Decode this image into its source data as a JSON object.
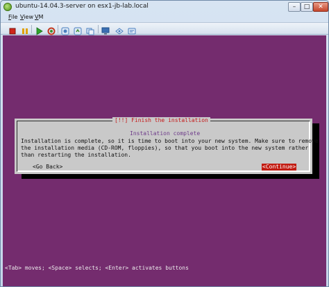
{
  "window": {
    "title": "ubuntu-14.04.3-server on esx1-jb-lab.local",
    "icon": "vm-console-app-icon",
    "controls": {
      "minimize": "–",
      "maximize": "□",
      "close": "✕"
    }
  },
  "menubar": {
    "items": [
      "File",
      "View",
      "VM"
    ]
  },
  "toolbar": {
    "buttons": [
      {
        "name": "power-off",
        "icon": "stop-square-icon",
        "color": "#d0261b"
      },
      {
        "name": "suspend",
        "icon": "pause-icon",
        "color": "#e0a100"
      },
      {
        "name": "power-on",
        "icon": "play-triangle-icon",
        "color": "#2fa52a"
      },
      {
        "name": "reset",
        "icon": "reset-icon",
        "color": "#c4391f"
      },
      {
        "name": "snapshot-take",
        "icon": "snapshot-icon",
        "color": "#4a7fbf"
      },
      {
        "name": "snapshot-revert",
        "icon": "snapshot-revert-icon",
        "color": "#4a7fbf"
      },
      {
        "name": "snapshot-manager",
        "icon": "snapshot-manager-icon",
        "color": "#4a7fbf"
      },
      {
        "name": "fullscreen",
        "icon": "monitor-icon",
        "color": "#3b6fb3"
      },
      {
        "name": "send-ctrl-alt-del",
        "icon": "keyboard-icon",
        "color": "#4a7fbf"
      },
      {
        "name": "vm-settings",
        "icon": "settings-icon",
        "color": "#4a7fbf"
      }
    ]
  },
  "console": {
    "background": "#742c6e",
    "dialog": {
      "title": "[!!] Finish the installation",
      "subtitle": "Installation complete",
      "lines": [
        "Installation is complete, so it is time to boot into your new system. Make sure to remove",
        "the installation media (CD-ROM, floppies), so that you boot into the new system rather",
        "than restarting the installation."
      ],
      "go_back": "<Go Back>",
      "continue": "<Continue>"
    },
    "status": "<Tab> moves; <Space> selects; <Enter> activates buttons"
  }
}
